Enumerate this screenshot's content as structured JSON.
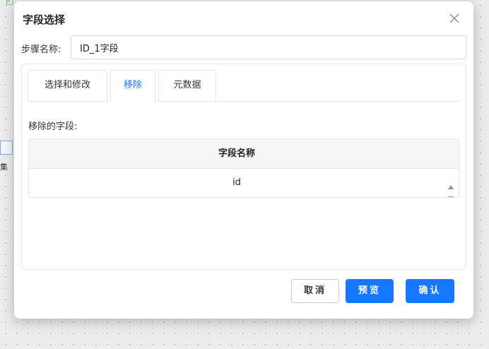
{
  "background": {
    "node_label": "集"
  },
  "dialog": {
    "title": "字段选择",
    "close_icon": "close-icon"
  },
  "step": {
    "label": "步骤名称:",
    "value": "ID_1字段"
  },
  "tabs": [
    {
      "label": "选择和修改",
      "active": false
    },
    {
      "label": "移除",
      "active": true
    },
    {
      "label": "元数据",
      "active": false
    }
  ],
  "removed": {
    "label": "移除的字段:",
    "table": {
      "columns": [
        "字段名称"
      ],
      "rows": [
        [
          "id"
        ]
      ]
    }
  },
  "footer": {
    "cancel_label": "取消",
    "preview_label": "预览",
    "confirm_label": "确认"
  },
  "colors": {
    "accent": "#1677ff",
    "border": "#e4e6ea"
  }
}
